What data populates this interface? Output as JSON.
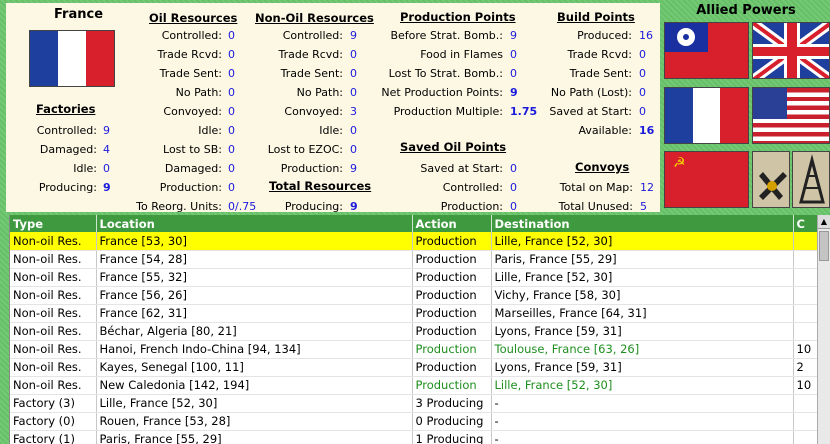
{
  "country": {
    "name": "France"
  },
  "factories": {
    "header": "Factories",
    "rows": [
      {
        "label": "Controlled:",
        "value": "9"
      },
      {
        "label": "Damaged:",
        "value": "4"
      },
      {
        "label": "Idle:",
        "value": "0"
      },
      {
        "label": "Producing:",
        "value": "9"
      }
    ]
  },
  "oil_resources": {
    "header": "Oil Resources",
    "rows": [
      {
        "label": "Controlled:",
        "value": "0"
      },
      {
        "label": "Trade Rcvd:",
        "value": "0"
      },
      {
        "label": "Trade Sent:",
        "value": "0"
      },
      {
        "label": "No Path:",
        "value": "0"
      },
      {
        "label": "Convoyed:",
        "value": "0"
      },
      {
        "label": "Idle:",
        "value": "0"
      },
      {
        "label": "Lost to SB:",
        "value": "0"
      },
      {
        "label": "Damaged:",
        "value": "0"
      },
      {
        "label": "Production:",
        "value": "0"
      },
      {
        "label": "To Reorg. Units:",
        "value": "0/.75"
      }
    ]
  },
  "non_oil_resources": {
    "header": "Non-Oil Resources",
    "rows": [
      {
        "label": "Controlled:",
        "value": "9"
      },
      {
        "label": "Trade Rcvd:",
        "value": "0"
      },
      {
        "label": "Trade Sent:",
        "value": "0"
      },
      {
        "label": "No Path:",
        "value": "0"
      },
      {
        "label": "Convoyed:",
        "value": "3"
      },
      {
        "label": "Idle:",
        "value": "0"
      },
      {
        "label": "Lost to EZOC:",
        "value": "0"
      },
      {
        "label": "Production:",
        "value": "9"
      }
    ]
  },
  "total_resources": {
    "header": "Total Resources",
    "rows": [
      {
        "label": "Producing:",
        "value": "9"
      }
    ]
  },
  "production_points": {
    "header": "Production Points",
    "rows": [
      {
        "label": "Before Strat. Bomb.:",
        "value": "9"
      },
      {
        "label": "Food in Flames",
        "value": "0"
      },
      {
        "label": "Lost To Strat. Bomb.:",
        "value": "0"
      },
      {
        "label": "Net Production Points:",
        "value": "9"
      },
      {
        "label": "Production Multiple:",
        "value": "1.75"
      }
    ]
  },
  "saved_oil_points": {
    "header": "Saved Oil Points",
    "rows": [
      {
        "label": "Saved at Start:",
        "value": "0"
      },
      {
        "label": "Controlled:",
        "value": "0"
      },
      {
        "label": "Production:",
        "value": "0"
      }
    ]
  },
  "build_points": {
    "header": "Build Points",
    "rows": [
      {
        "label": "Produced:",
        "value": "16"
      },
      {
        "label": "Trade Rcvd:",
        "value": "0"
      },
      {
        "label": "Trade Sent:",
        "value": "0"
      },
      {
        "label": "No Path (Lost):",
        "value": "0"
      },
      {
        "label": "Saved at Start:",
        "value": "0"
      },
      {
        "label": "Available:",
        "value": "16"
      }
    ]
  },
  "convoys": {
    "header": "Convoys",
    "rows": [
      {
        "label": "Total on Map:",
        "value": "12"
      },
      {
        "label": "Total Unused:",
        "value": "5"
      }
    ]
  },
  "allied_powers": {
    "title": "Allied Powers",
    "flags": [
      "china-flag",
      "uk-flag",
      "france-flag",
      "usa-flag",
      "ussr-flag",
      "resource-icon",
      "oil-derrick-icon"
    ]
  },
  "table": {
    "columns": [
      "Type",
      "Location",
      "Action",
      "Destination",
      "C"
    ],
    "rows": [
      {
        "type": "Non-oil Res.",
        "location": "France [53, 30]",
        "action": "Production",
        "destination": "Lille, France [52, 30]",
        "c": "",
        "selected": true,
        "green": false
      },
      {
        "type": "Non-oil Res.",
        "location": "France [54, 28]",
        "action": "Production",
        "destination": "Paris, France [55, 29]",
        "c": "",
        "selected": false,
        "green": false
      },
      {
        "type": "Non-oil Res.",
        "location": "France [55, 32]",
        "action": "Production",
        "destination": "Lille, France [52, 30]",
        "c": "",
        "selected": false,
        "green": false
      },
      {
        "type": "Non-oil Res.",
        "location": "France [56, 26]",
        "action": "Production",
        "destination": "Vichy, France [58, 30]",
        "c": "",
        "selected": false,
        "green": false
      },
      {
        "type": "Non-oil Res.",
        "location": "France [62, 31]",
        "action": "Production",
        "destination": "Marseilles, France [64, 31]",
        "c": "",
        "selected": false,
        "green": false
      },
      {
        "type": "Non-oil Res.",
        "location": "Béchar, Algeria [80, 21]",
        "action": "Production",
        "destination": "Lyons, France [59, 31]",
        "c": "",
        "selected": false,
        "green": false
      },
      {
        "type": "Non-oil Res.",
        "location": "Hanoi, French Indo-China [94, 134]",
        "action": "Production",
        "destination": "Toulouse, France [63, 26]",
        "c": "10",
        "selected": false,
        "green": true
      },
      {
        "type": "Non-oil Res.",
        "location": "Kayes, Senegal [100, 11]",
        "action": "Production",
        "destination": "Lyons, France [59, 31]",
        "c": "2",
        "selected": false,
        "green": false
      },
      {
        "type": "Non-oil Res.",
        "location": "New Caledonia [142, 194]",
        "action": "Production",
        "destination": "Lille, France [52, 30]",
        "c": "10",
        "selected": false,
        "green": true
      },
      {
        "type": "Factory (3)",
        "location": "Lille, France [52, 30]",
        "action": "3 Producing",
        "destination": "-",
        "c": "",
        "selected": false,
        "green": false
      },
      {
        "type": "Factory (0)",
        "location": "Rouen, France [53, 28]",
        "action": "0 Producing",
        "destination": "-",
        "c": "",
        "selected": false,
        "green": false
      },
      {
        "type": "Factory (1)",
        "location": "Paris, France [55, 29]",
        "action": "1 Producing",
        "destination": "-",
        "c": "",
        "selected": false,
        "green": false
      }
    ]
  }
}
